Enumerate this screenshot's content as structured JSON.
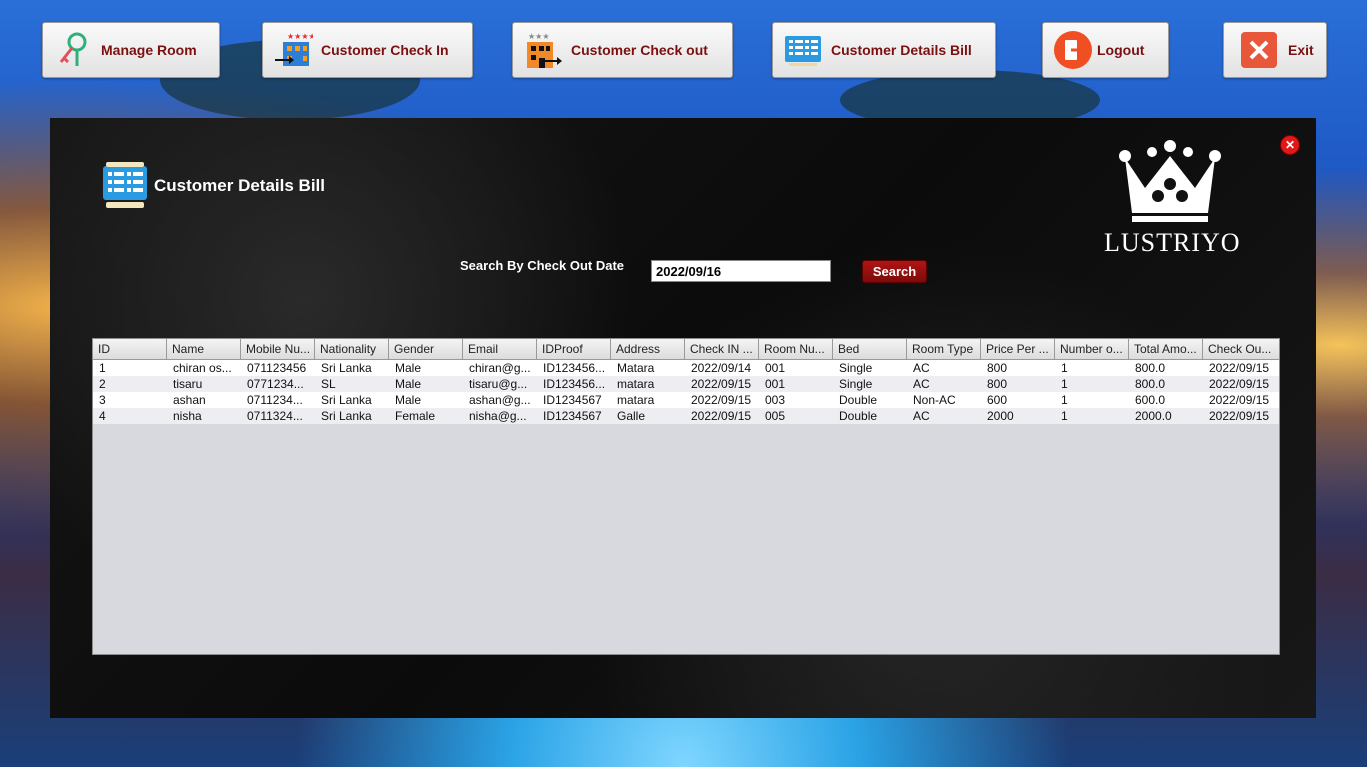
{
  "topbar": {
    "manage_room": "Manage Room",
    "check_in": "Customer Check In",
    "check_out": "Customer Check out",
    "details_bill": "Customer Details Bill",
    "logout": "Logout",
    "exit": "Exit"
  },
  "panel": {
    "close_symbol": "✕",
    "title": "Customer Details Bill",
    "logo_text": "LUSTRIYO",
    "search_label": "Search By Check Out Date",
    "search_value": "2022/09/16",
    "search_button": "Search"
  },
  "table": {
    "headers": [
      "ID",
      "Name",
      "Mobile Nu...",
      "Nationality",
      "Gender",
      "Email",
      "IDProof",
      "Address",
      "Check IN ...",
      "Room Nu...",
      "Bed",
      "Room Type",
      "Price Per ...",
      "Number o...",
      "Total Amo...",
      "Check Ou..."
    ],
    "rows": [
      [
        "1",
        "chiran os...",
        "071123456",
        "Sri Lanka",
        "Male",
        "chiran@g...",
        "ID123456...",
        "Matara",
        "2022/09/14",
        "001",
        "Single",
        "AC",
        "800",
        "1",
        "800.0",
        "2022/09/15"
      ],
      [
        "2",
        "tisaru",
        "0771234...",
        "SL",
        "Male",
        "tisaru@g...",
        "ID123456...",
        "matara",
        "2022/09/15",
        "001",
        "Single",
        "AC",
        "800",
        "1",
        "800.0",
        "2022/09/15"
      ],
      [
        "3",
        "ashan",
        "0711234...",
        "Sri Lanka",
        "Male",
        "ashan@g...",
        "ID1234567",
        "matara",
        "2022/09/15",
        "003",
        "Double",
        "Non-AC",
        "600",
        "1",
        "600.0",
        "2022/09/15"
      ],
      [
        "4",
        "nisha",
        "0711324...",
        "Sri Lanka",
        "Female",
        "nisha@g...",
        "ID1234567",
        "Galle",
        "2022/09/15",
        "005",
        "Double",
        "AC",
        "2000",
        "1",
        "2000.0",
        "2022/09/15"
      ]
    ]
  },
  "colors": {
    "button_text": "#7a1010",
    "search_button": "#a01010",
    "close_button": "#e01818"
  },
  "icons": {
    "manage_room": "key-icon",
    "check_in": "hotel-check-in-icon",
    "check_out": "hotel-check-out-icon",
    "details_bill": "bill-list-icon",
    "logout": "logout-icon",
    "exit": "exit-icon"
  }
}
